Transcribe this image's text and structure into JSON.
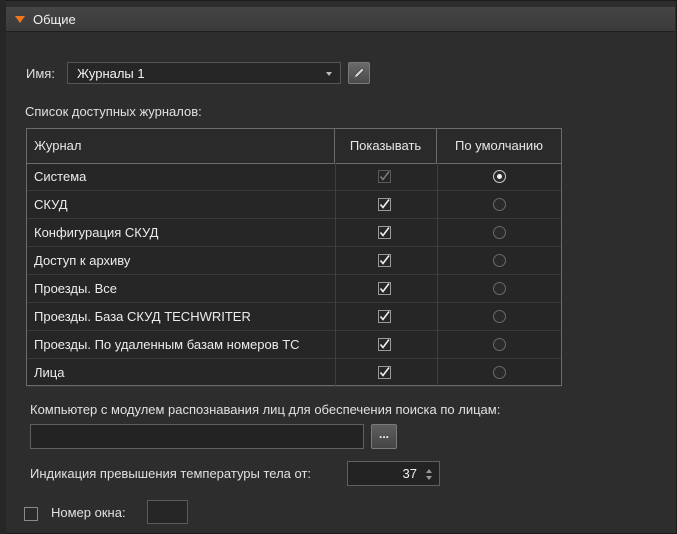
{
  "section": {
    "title": "Общие"
  },
  "name_field": {
    "label": "Имя:",
    "value": "Журналы 1",
    "edit_icon": "pencil-icon"
  },
  "journals": {
    "caption": "Список доступных журналов:",
    "columns": [
      "Журнал",
      "Показывать",
      "По умолчанию"
    ],
    "rows": [
      {
        "name": "Система",
        "show": true,
        "show_disabled": true,
        "default": true
      },
      {
        "name": "СКУД",
        "show": true,
        "show_disabled": false,
        "default": false
      },
      {
        "name": "Конфигурация СКУД",
        "show": true,
        "show_disabled": false,
        "default": false
      },
      {
        "name": "Доступ к архиву",
        "show": true,
        "show_disabled": false,
        "default": false
      },
      {
        "name": "Проезды. Все",
        "show": true,
        "show_disabled": false,
        "default": false
      },
      {
        "name": "Проезды. База СКУД TECHWRITER",
        "show": true,
        "show_disabled": false,
        "default": false
      },
      {
        "name": "Проезды. По удаленным базам номеров ТС",
        "show": true,
        "show_disabled": false,
        "default": false
      },
      {
        "name": "Лица",
        "show": true,
        "show_disabled": false,
        "default": false
      }
    ]
  },
  "face_search": {
    "label": "Компьютер с модулем распознавания лиц для обеспечения поиска по лицам:",
    "value": "",
    "browse_label": "..."
  },
  "temperature": {
    "label": "Индикация превышения температуры тела от:",
    "value": "37"
  },
  "window_number": {
    "label": "Номер окна:",
    "checked": false,
    "value": ""
  },
  "colors": {
    "accent": "#f2761c",
    "background": "#2d2d2d"
  }
}
